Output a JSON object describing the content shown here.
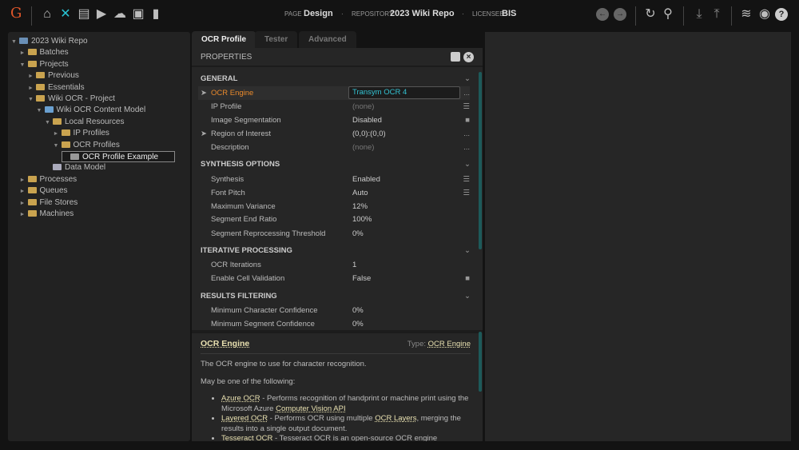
{
  "header": {
    "page_label": "PAGE",
    "page": "Design",
    "repo_label": "REPOSITORY",
    "repo": "2023 Wiki Repo",
    "licensee_label": "LICENSEE",
    "licensee": "BIS"
  },
  "tree": [
    {
      "label": "2023 Wiki Repo",
      "depth": 0,
      "arrow": "▼",
      "icon": "repo"
    },
    {
      "label": "Batches",
      "depth": 1,
      "arrow": "►",
      "icon": "folder"
    },
    {
      "label": "Projects",
      "depth": 1,
      "arrow": "▼",
      "icon": "folder"
    },
    {
      "label": "Previous",
      "depth": 2,
      "arrow": "►",
      "icon": "folder"
    },
    {
      "label": "Essentials",
      "depth": 2,
      "arrow": "►",
      "icon": "project"
    },
    {
      "label": "Wiki OCR - Project",
      "depth": 2,
      "arrow": "▼",
      "icon": "project"
    },
    {
      "label": "Wiki OCR Content Model",
      "depth": 3,
      "arrow": "▼",
      "icon": "model"
    },
    {
      "label": "Local Resources",
      "depth": 4,
      "arrow": "▼",
      "icon": "folder"
    },
    {
      "label": "IP Profiles",
      "depth": 5,
      "arrow": "►",
      "icon": "folder"
    },
    {
      "label": "OCR Profiles",
      "depth": 5,
      "arrow": "▼",
      "icon": "folder"
    },
    {
      "label": "OCR Profile Example",
      "depth": 6,
      "arrow": "",
      "icon": "profile",
      "selected": true
    },
    {
      "label": "Data Model",
      "depth": 4,
      "arrow": "",
      "icon": "datamodel"
    },
    {
      "label": "Processes",
      "depth": 1,
      "arrow": "►",
      "icon": "folder"
    },
    {
      "label": "Queues",
      "depth": 1,
      "arrow": "►",
      "icon": "folder"
    },
    {
      "label": "File Stores",
      "depth": 1,
      "arrow": "►",
      "icon": "folder"
    },
    {
      "label": "Machines",
      "depth": 1,
      "arrow": "►",
      "icon": "folder"
    }
  ],
  "tabs": [
    "OCR Profile",
    "Tester",
    "Advanced"
  ],
  "properties_title": "PROPERTIES",
  "sections": [
    {
      "title": "GENERAL",
      "rows": [
        {
          "k": "OCR Engine",
          "v": "Transym OCR 4",
          "e": "...",
          "arrow": true,
          "active": true
        },
        {
          "k": "IP Profile",
          "v": "(none)",
          "e": "☰",
          "dim": true
        },
        {
          "k": "Image Segmentation",
          "v": "Disabled",
          "e": "■"
        },
        {
          "k": "Region of Interest",
          "v": "(0,0):(0,0)",
          "e": "...",
          "arrow": true
        },
        {
          "k": "Description",
          "v": "(none)",
          "e": "...",
          "dim": true
        }
      ]
    },
    {
      "title": "SYNTHESIS OPTIONS",
      "rows": [
        {
          "k": "Synthesis",
          "v": "Enabled",
          "e": "☰"
        },
        {
          "k": "Font Pitch",
          "v": "Auto",
          "e": "☰"
        },
        {
          "k": "Maximum Variance",
          "v": "12%",
          "e": ""
        },
        {
          "k": "Segment End Ratio",
          "v": "100%",
          "e": ""
        },
        {
          "k": "Segment Reprocessing Threshold",
          "v": "0%",
          "e": ""
        }
      ]
    },
    {
      "title": "ITERATIVE PROCESSING",
      "rows": [
        {
          "k": "OCR Iterations",
          "v": "1",
          "e": ""
        },
        {
          "k": "Enable Cell Validation",
          "v": "False",
          "e": "■"
        }
      ]
    },
    {
      "title": "RESULTS FILTERING",
      "rows": [
        {
          "k": "Minimum Character Confidence",
          "v": "0%",
          "e": ""
        },
        {
          "k": "Minimum Segment Confidence",
          "v": "0%",
          "e": ""
        }
      ]
    }
  ],
  "help": {
    "title": "OCR Engine",
    "type_label": "Type:",
    "type": "OCR Engine",
    "desc": "The OCR engine to use for character recognition.",
    "intro": "May be one of the following:",
    "items": [
      {
        "name": "Azure OCR",
        "text": " - Performs recognition of handprint or machine print using the Microsoft Azure ",
        "link": "Computer Vision API",
        "tail": ""
      },
      {
        "name": "Layered OCR",
        "text": " - Performs OCR using multiple ",
        "link": "OCR Layers",
        "tail": ", merging the results into a single output document."
      },
      {
        "name": "Tesseract OCR",
        "text": " - Tesseract OCR is an open-source OCR engine sponsored",
        "link": "",
        "tail": ""
      }
    ]
  }
}
